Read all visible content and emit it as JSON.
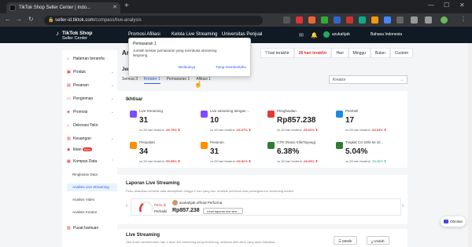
{
  "browser": {
    "tab_title": "TikTok Shop Seller Center | Indo...",
    "url_domain": "seller-id.tiktok.com",
    "url_path": "/compass/live-analysis"
  },
  "header": {
    "logo_line1": "TikTok Shop",
    "logo_line2": "Seller Center",
    "nav": [
      "Promosi Afiliasi",
      "Kelola Live Streaming",
      "Universitas Penjual"
    ],
    "user": "azukahjab",
    "lang": "Bahasa Indonesia"
  },
  "sidebar": {
    "items": [
      {
        "label": "Halaman beranda",
        "icon": "home-icon"
      },
      {
        "label": "Produk",
        "icon": "box-icon"
      },
      {
        "label": "Pesanan",
        "icon": "order-icon"
      },
      {
        "label": "Pengiriman",
        "icon": "truck-icon"
      },
      {
        "label": "Promosi",
        "icon": "promo-icon"
      },
      {
        "label": "Dekorasi Toko",
        "icon": "store-icon"
      },
      {
        "label": "Keuangan",
        "icon": "wallet-icon"
      },
      {
        "label": "Iklan",
        "icon": "ads-icon",
        "badge": "Baru"
      },
      {
        "label": "Kompas Data",
        "icon": "chart-icon"
      },
      {
        "label": "Pusat bantuan",
        "icon": "help-icon"
      }
    ],
    "subitems": [
      "Ringkasan Data",
      "Analisis Live Streaming",
      "Analisis Video",
      "Analisis Kreator"
    ]
  },
  "page": {
    "title": "Analisis",
    "periods": [
      "7 hari terakhir",
      "28 hari terakhir",
      "Hari",
      "Minggu",
      "Bulan",
      "Custom"
    ],
    "active_period": "28 hari terakhir",
    "jenis": "Jenis a",
    "tabs": [
      "Semua 3",
      "Kreator 1",
      "Pemasaran 1",
      "Afiliasi 1"
    ],
    "select": "Kreator"
  },
  "tooltip": {
    "title": "Pemasaran 1",
    "body": "Jumlah kreator pemasaran yang membuka streaming langsung",
    "btn1": "Berikutnya",
    "btn2": "Tutup memberitahu"
  },
  "overview": {
    "title": "Ikhtisar",
    "metrics": [
      {
        "label": "Live Streaming",
        "value": "31",
        "cmp": "vs 28 hari terakhir",
        "delta": "-35.75% ⬇",
        "dir": "down",
        "color": "#7c4dff"
      },
      {
        "label": "Live streaming dengan ...",
        "value": "10",
        "cmp": "vs 28 hari terakhir",
        "delta": "-66.67% ⬇",
        "dir": "down",
        "color": "#7c4dff"
      },
      {
        "label": "Penghasilan",
        "value": "Rp857.238",
        "cmp": "vs 28 hari terakhir",
        "delta": "-65.62% ⬇",
        "dir": "down",
        "color": "#e53935"
      },
      {
        "label": "Pembeli",
        "value": "17",
        "cmp": "vs 28 hari terakhir",
        "delta": "-63.04% ⬇",
        "dir": "down",
        "color": "#1e88e5"
      },
      {
        "label": "Penjualan",
        "value": "34",
        "cmp": "vs 28 hari terakhir",
        "delta": "-55.95% ⬇",
        "dir": "down",
        "color": "#ff8f00"
      },
      {
        "label": "Pesanan",
        "value": "31",
        "cmp": "vs 28 hari terakhir",
        "delta": "-66.52% ⬇",
        "dir": "down",
        "color": "#ff8f00"
      },
      {
        "label": "CTR (Rasio Klik/Tayang)",
        "value": "6.38%",
        "cmp": "vs 28 hari terakhir",
        "delta": "-46.03% ⬇",
        "dir": "down",
        "color": "#2e7d32"
      },
      {
        "label": "Tingkat CO (Klik ke Or...",
        "value": "5.04%",
        "cmp": "vs 28 hari terakhir",
        "delta": "-38.48% ⬆",
        "dir": "up",
        "color": "#2e7d32"
      }
    ]
  },
  "live": {
    "title": "Laporan Live Streaming",
    "sub": "Perlu dilakukan kembali data ditampilkan hingga 2 hari yang lalu. Analisis performa total perangkat live streaming kreator",
    "gauge_label": "Perlu di",
    "gauge_label2": "Perbaiki",
    "gauge_value": "Perlu di",
    "name": "azukahjab.official Performa",
    "value": "Rp857.238",
    "btn": "Lihat laporan live stre..."
  },
  "live2": {
    "title": "Live Streaming",
    "sub": "Jika Anda memiliki lebih dari 1 akun live streaming yang terhubung, silahkan pilih akun yang akan dianalisa.",
    "btn1": "Metrik",
    "btn2": "Unduh"
  },
  "chat": "Obrolan"
}
